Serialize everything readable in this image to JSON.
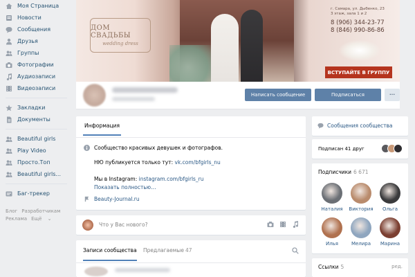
{
  "sidebar": {
    "items": [
      {
        "label": "Моя Страница",
        "icon": "home-icon"
      },
      {
        "label": "Новости",
        "icon": "news-icon"
      },
      {
        "label": "Сообщения",
        "icon": "message-icon"
      },
      {
        "label": "Друзья",
        "icon": "user-icon"
      },
      {
        "label": "Группы",
        "icon": "users-icon"
      },
      {
        "label": "Фотографии",
        "icon": "camera-icon"
      },
      {
        "label": "Аудиозаписи",
        "icon": "music-icon"
      },
      {
        "label": "Видеозаписи",
        "icon": "film-icon"
      }
    ],
    "items2": [
      {
        "label": "Закладки",
        "icon": "star-icon"
      },
      {
        "label": "Документы",
        "icon": "document-icon"
      }
    ],
    "groups": [
      {
        "label": "Beautiful girls",
        "icon": "users-icon"
      },
      {
        "label": "Play Video",
        "icon": "users-icon"
      },
      {
        "label": "Просто.Топ",
        "icon": "users-icon"
      },
      {
        "label": "Beautiful girls...",
        "icon": "users-icon"
      }
    ],
    "extra": {
      "label": "Баг-трекер",
      "icon": "bug-icon"
    },
    "footer": [
      "Блог",
      "Разработчикам",
      "Реклама",
      "Ещё"
    ]
  },
  "cover": {
    "brand": "ДОМ СВАДЬБЫ",
    "brand_sub": "wedding dress",
    "address_line1": "г. Самара, ул. Дыбенко, 23",
    "address_line2": "3 этаж, зала 1 и 2",
    "phone1": "8 (906) 344-23-77",
    "phone2": "8 (846) 990-86-86",
    "join_button": "ВСТУПАЙТЕ В ГРУППУ"
  },
  "profile": {
    "message_button": "Написать сообщение",
    "subscribe_button": "Подписаться",
    "more_button": "···"
  },
  "info": {
    "tab": "Информация",
    "description": "Сообщество красивых девушек и фотографов.",
    "nu_prefix": "НЮ публикуется только тут: ",
    "nu_link": "vk.com/bfgirls_nu",
    "insta_prefix": "Мы в Instagram: ",
    "insta_link": "instagram.com/bfgirls_ru",
    "more_link": "Показать полностью…",
    "site_link": "Beauty-Journal.ru"
  },
  "postbox": {
    "placeholder": "Что у Вас нового?"
  },
  "wall": {
    "tab_active": "Записи сообщества",
    "tab_second": "Предлагаемые",
    "tab_second_count": "47"
  },
  "right": {
    "messages_label": "Сообщения сообщества",
    "friends_label": "Подписан 41 друг",
    "subscribers_label": "Подписчики",
    "subscribers_count": "6 671",
    "subscribers": [
      {
        "name": "Наталия",
        "color": "#6b6f75"
      },
      {
        "name": "Виктория",
        "color": "#b98b6c"
      },
      {
        "name": "Ольга",
        "color": "#3a3a3c"
      },
      {
        "name": "Илья",
        "color": "#b0714f"
      },
      {
        "name": "Мелира",
        "color": "#8fa6bf"
      },
      {
        "name": "Марина",
        "color": "#7b3f31"
      }
    ],
    "links_label": "Ссылки",
    "links_count": "5",
    "links_edit": "ред."
  },
  "colors": {
    "accent": "#5181b8",
    "button": "#5e81a8",
    "link": "#2a5885",
    "background": "#edeef0",
    "join_button": "#b5341e"
  }
}
